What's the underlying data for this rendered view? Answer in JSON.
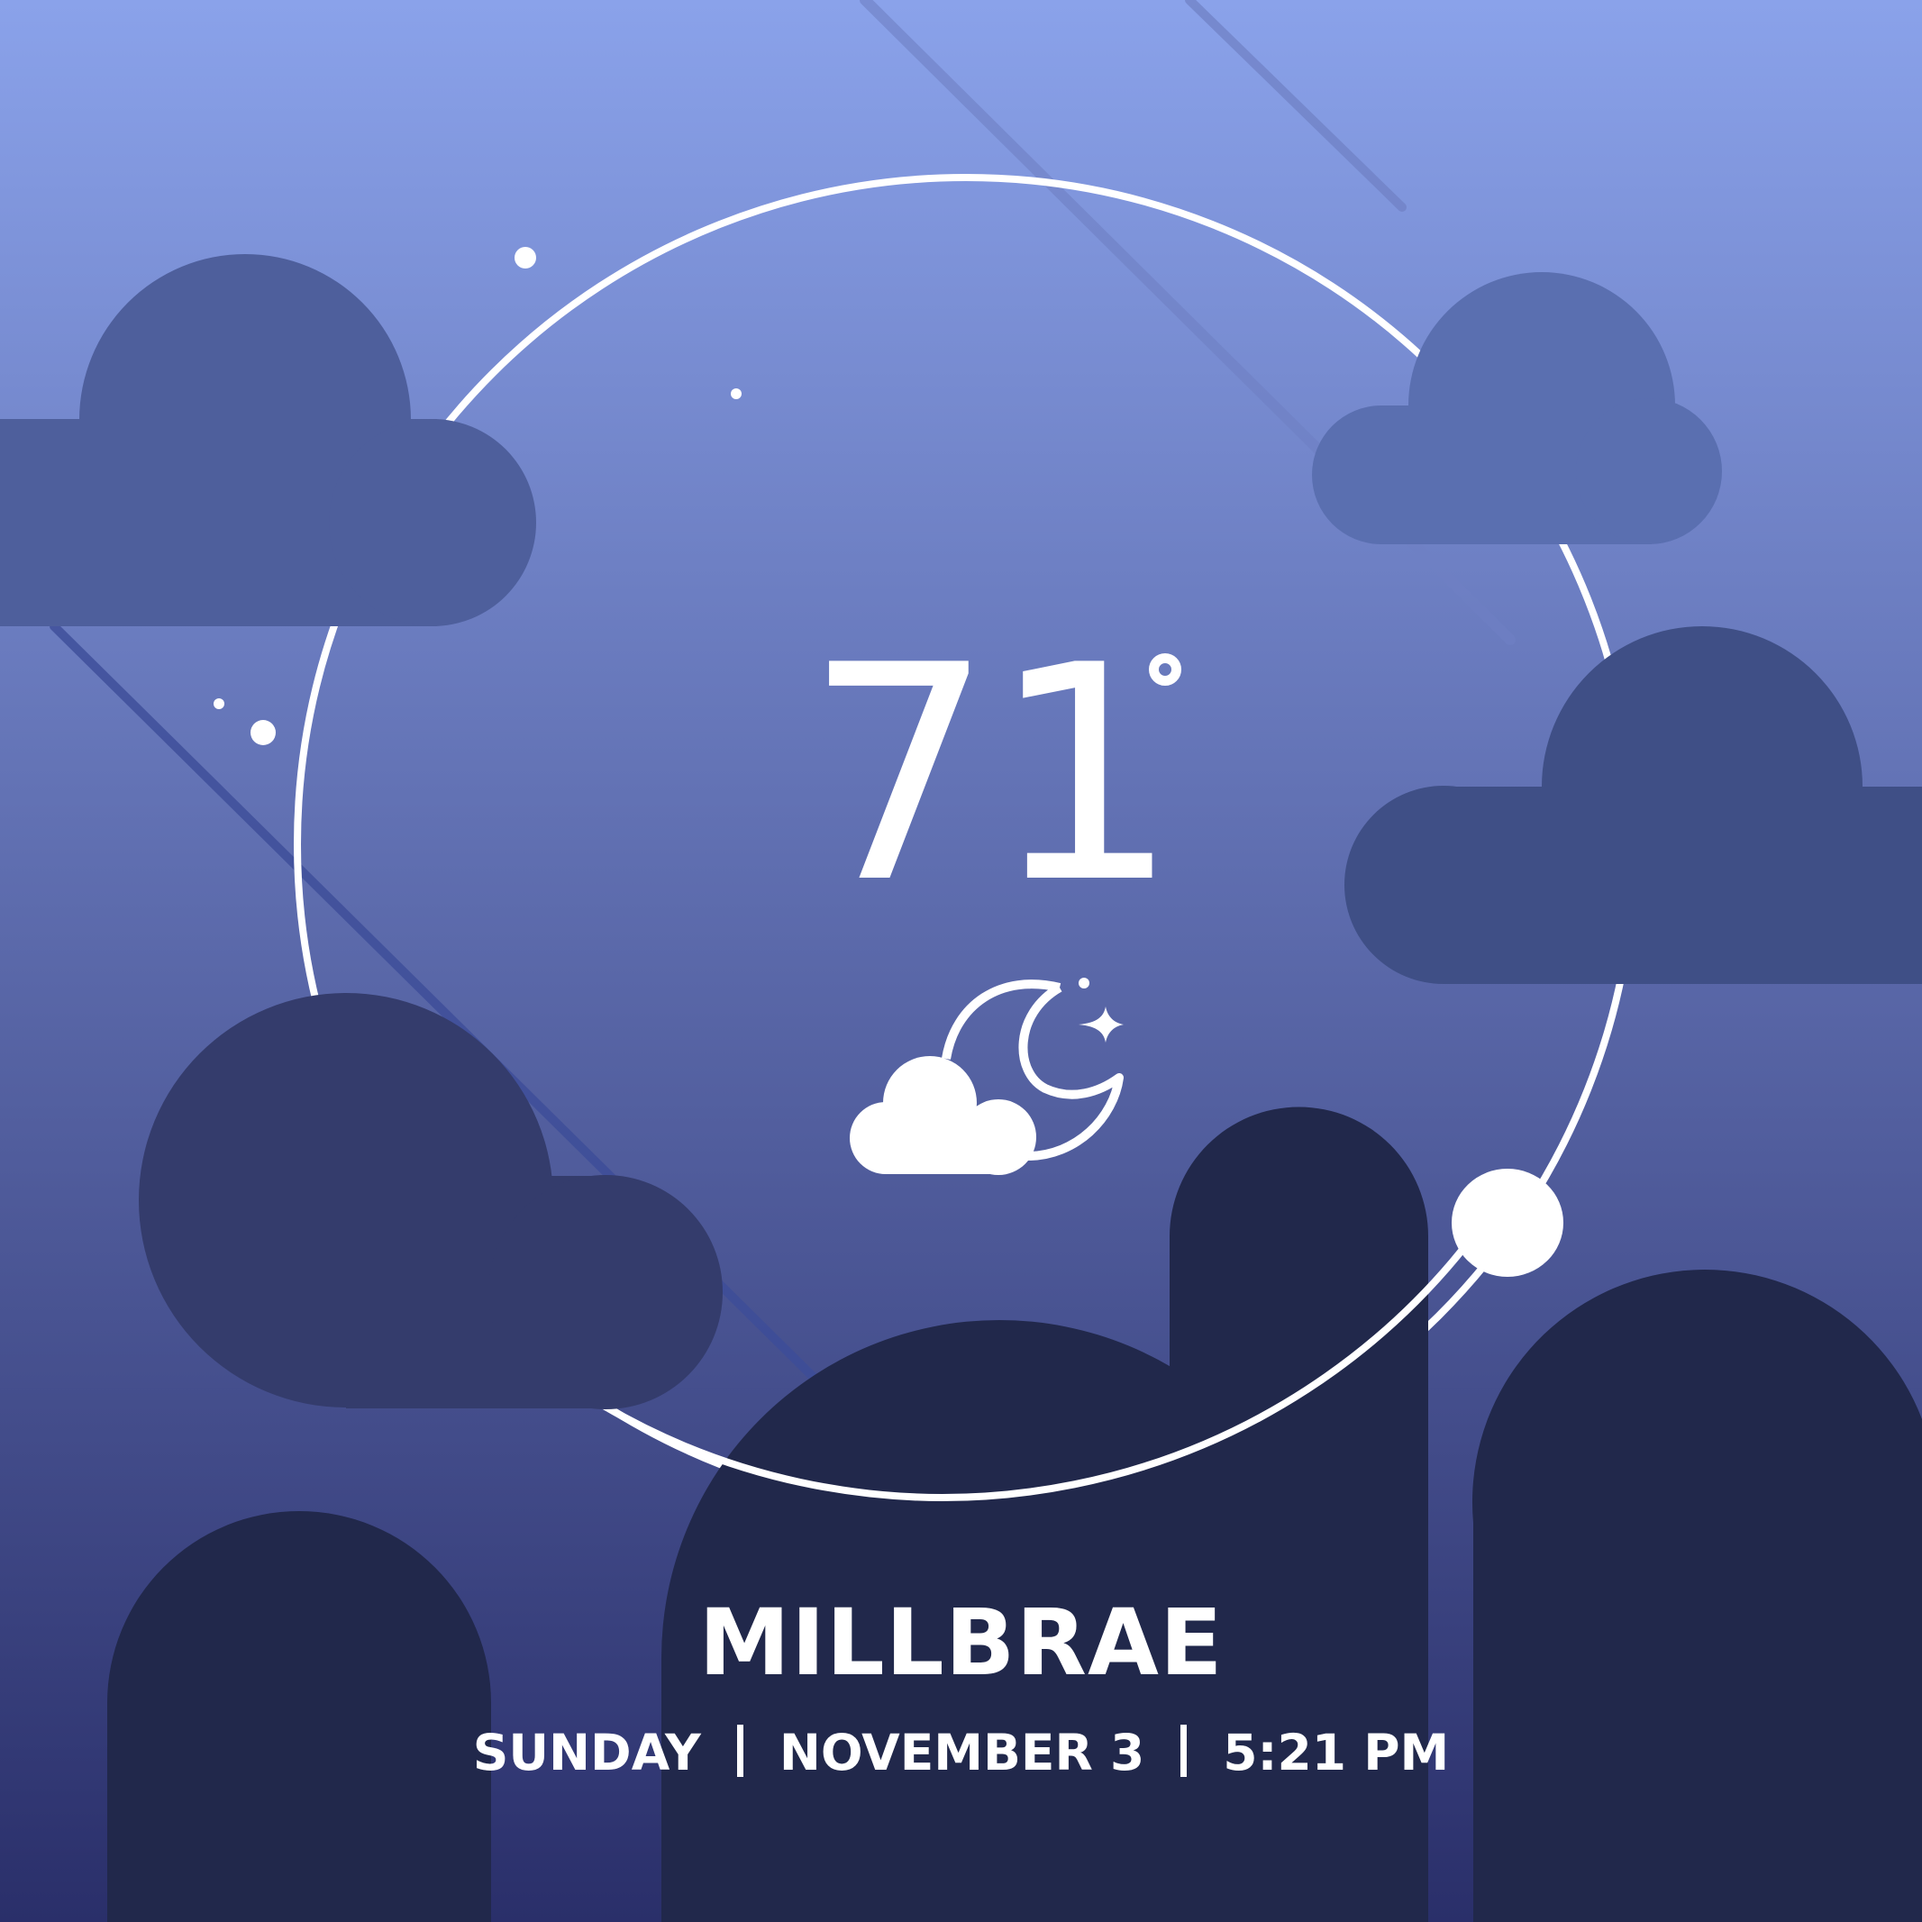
{
  "weather": {
    "temperature": "71",
    "unit_symbol": "°",
    "condition_icon": "partly-cloudy-night-icon"
  },
  "location": {
    "city": "MILLBRAE"
  },
  "datetime": {
    "day": "SUNDAY",
    "date": "NOVEMBER 3",
    "time": "5:21 PM"
  },
  "colors": {
    "sky_top": "#8aa2ea",
    "sky_mid": "#5a68a9",
    "sky_bottom": "#2a2f6a",
    "cloud_light": "#5a6fb0",
    "cloud_mid": "#4e5f9c",
    "cloud_dark": "#3f4f86",
    "cloud_darkest": "#343c6c",
    "hills": "#21284b",
    "foreground": "#ffffff"
  }
}
